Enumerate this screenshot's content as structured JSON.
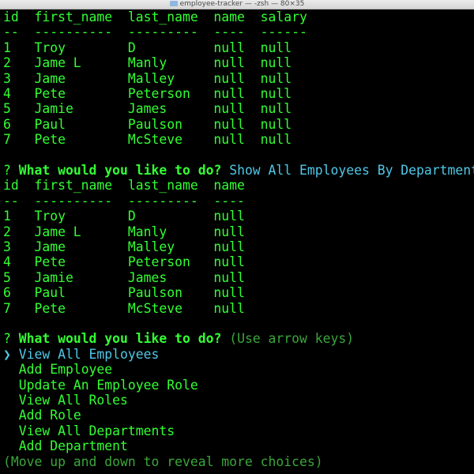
{
  "window": {
    "title": "employee-tracker — -zsh — 80×35"
  },
  "table1": {
    "header": "id  first_name  last_name  name  salary",
    "divider": "--  ----------  ---------  ----  ------",
    "rows": [
      "1   Troy        D          null  null",
      "2   Jame L      Manly      null  null",
      "3   Jame        Malley     null  null",
      "4   Pete        Peterson   null  null",
      "5   Jamie       James      null  null",
      "6   Paul        Paulson    null  null",
      "7   Pete        McSteve    null  null"
    ]
  },
  "prompt1": {
    "mark": "?",
    "question": "What would you like to do?",
    "answer": "Show All Employees By Department"
  },
  "table2": {
    "header": "id  first_name  last_name  name",
    "divider": "--  ----------  ---------  ----",
    "rows": [
      "1   Troy        D          null",
      "2   Jame L      Manly      null",
      "3   Jame        Malley     null",
      "4   Pete        Peterson   null",
      "5   Jamie       James      null",
      "6   Paul        Paulson    null",
      "7   Pete        McSteve    null"
    ]
  },
  "prompt2": {
    "mark": "?",
    "question": "What would you like to do?",
    "hint": "(Use arrow keys)"
  },
  "menu": {
    "pointer": "❯",
    "items": [
      "View All Employees",
      "Add Employee",
      "Update An Employee Role",
      "View All Roles",
      "Add Role",
      "View All Departments",
      "Add Department"
    ],
    "selected_index": 0,
    "footer": "(Move up and down to reveal more choices)"
  },
  "colors": {
    "text": "#33ff33",
    "answer": "#4fc8e8",
    "hint": "#3aa63a",
    "background": "#000000"
  }
}
